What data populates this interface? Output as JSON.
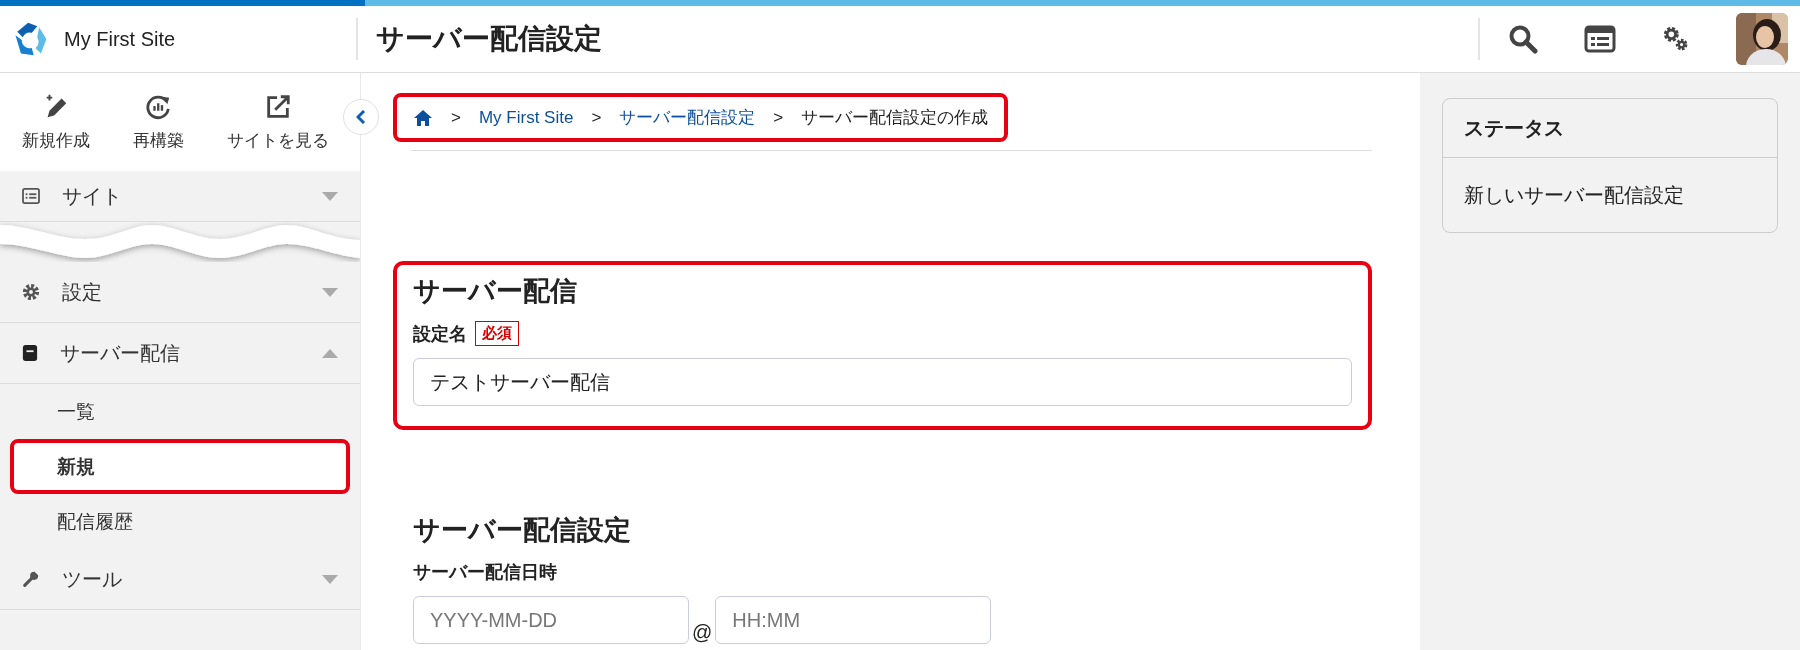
{
  "header": {
    "site_name": "My First Site",
    "page_title": "サーバー配信設定"
  },
  "toolbar": [
    {
      "label": "新規作成",
      "kind": "create"
    },
    {
      "label": "再構築",
      "kind": "rebuild"
    },
    {
      "label": "サイトを見る",
      "kind": "view"
    }
  ],
  "sidebar": {
    "items": [
      {
        "label": "サイト",
        "kind": "site",
        "expanded": false
      },
      {
        "label": "設定",
        "kind": "settings",
        "expanded": false
      },
      {
        "label": "サーバー配信",
        "kind": "server",
        "expanded": true,
        "children": [
          {
            "label": "一覧",
            "selected": false,
            "highlighted": false
          },
          {
            "label": "新規",
            "selected": true,
            "highlighted": true
          },
          {
            "label": "配信履歴",
            "selected": false,
            "highlighted": false
          }
        ]
      },
      {
        "label": "ツール",
        "kind": "tools",
        "expanded": false
      }
    ]
  },
  "breadcrumb": {
    "highlighted": true,
    "separator": ">",
    "items": [
      {
        "kind": "home"
      },
      {
        "kind": "link",
        "label": "My First Site"
      },
      {
        "kind": "link",
        "label": "サーバー配信設定"
      },
      {
        "kind": "current",
        "label": "サーバー配信設定の作成"
      }
    ]
  },
  "sections": [
    {
      "title": "サーバー配信",
      "highlighted": true,
      "fields": [
        {
          "kind": "text",
          "label": "設定名",
          "required_badge": "必須",
          "value": "テストサーバー配信"
        }
      ]
    },
    {
      "title": "サーバー配信設定",
      "highlighted": false,
      "fields": [
        {
          "kind": "datetime",
          "label": "サーバー配信日時",
          "date_placeholder": "YYYY-MM-DD",
          "separator": "@",
          "time_placeholder": "HH:MM"
        }
      ]
    }
  ],
  "status_panel": {
    "title": "ステータス",
    "text": "新しいサーバー配信設定"
  }
}
